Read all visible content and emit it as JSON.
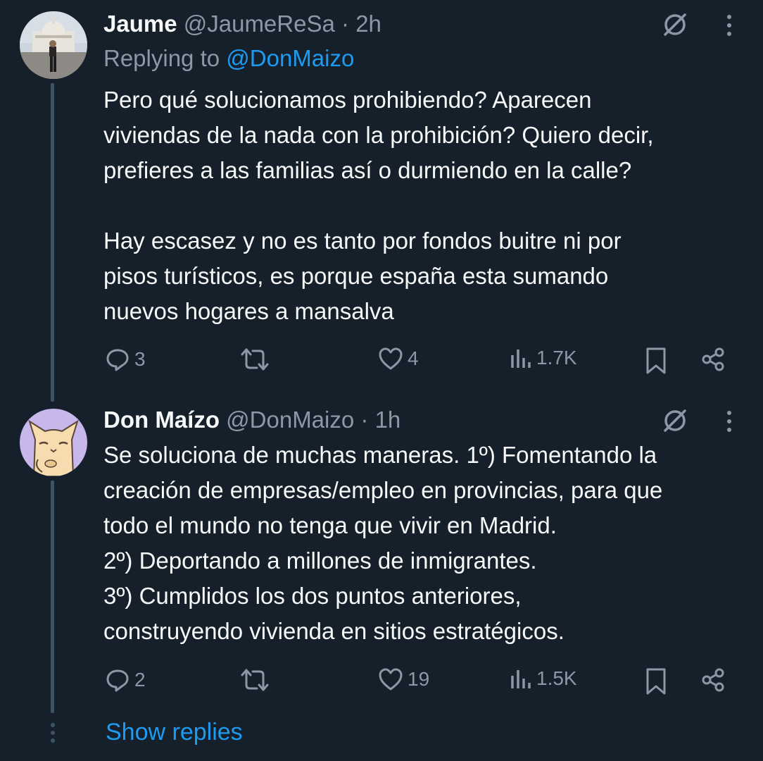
{
  "tweets": [
    {
      "name": "Jaume",
      "handle": "@JaumeReSa",
      "dot": "·",
      "time": "2h",
      "replying_prefix": "Replying to ",
      "replying_handle": "@DonMaizo",
      "paragraphs": [
        "Pero qué solucionamos prohibiendo? Aparecen",
        "viviendas de la nada con la prohibición? Quiero decir,",
        "prefieres a las familias así o durmiendo en la calle?",
        "",
        "Hay escasez y no es tanto por fondos buitre ni por",
        "pisos turísticos, es porque españa esta sumando",
        "nuevos hogares a mansalva"
      ],
      "replies": "3",
      "likes": "4",
      "views": "1.7K"
    },
    {
      "name": "Don Maízo",
      "handle": "@DonMaizo",
      "dot": "·",
      "time": "1h",
      "paragraphs": [
        "Se soluciona de muchas maneras. 1º) Fomentando la",
        "creación de empresas/empleo en provincias, para que",
        "todo el mundo no tenga que vivir en Madrid.",
        "2º) Deportando a millones de inmigrantes.",
        "3º) Cumplidos los dos puntos anteriores,",
        "construyendo vivienda en sitios estratégicos."
      ],
      "replies": "2",
      "likes": "19",
      "views": "1.5K"
    }
  ],
  "show_replies": "Show replies",
  "colors": {
    "background": "#15202b",
    "text": "#f7f9f9",
    "muted": "#8b98a5",
    "accent": "#1d9bf0",
    "thread_line": "#3d5466"
  },
  "icons": [
    "grok-icon",
    "more-icon",
    "reply-icon",
    "retweet-icon",
    "like-icon",
    "views-icon",
    "bookmark-icon",
    "share-icon"
  ]
}
